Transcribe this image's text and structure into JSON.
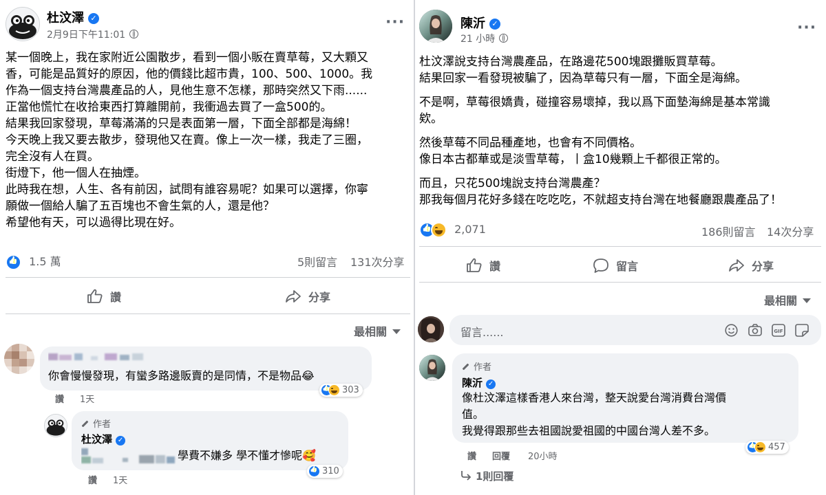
{
  "left_post": {
    "author": "杜汶澤",
    "timestamp": "2月9日下午11:01",
    "body_lines": [
      "某一個晚上，我在家附近公園散步，看到一個小販在賣草莓，又大顆又",
      "香，可能是品質好的原因，他的價錢比超市貴，100、500、1000。我",
      "作為一個支持台灣農產品的人，見他生意不怎樣，那時突然又下雨......",
      "正當他慌忙在收拾東西打算離開前，我衝過去買了一盒500的。",
      "結果我回家發現，草莓滿滿的只是表面第一層，下面全部都是海綿！",
      "今天晚上我又要去散步，發現他又在賣。像上一次一樣，我走了三圈，",
      "完全沒有人在買。",
      "街燈下，他一個人在抽煙。",
      "此時我在想，人生、各有前因，試問有誰容易呢？如果可以選擇，你寧",
      "願做一個給人騙了五百塊也不會生氣的人，還是他？",
      "希望他有天，可以過得比現在好。"
    ],
    "reactions_count": "1.5 萬",
    "comments_count": "5則留言",
    "shares_count": "131次分享",
    "like_label": "讚",
    "share_label": "分享",
    "sort_label": "最相關",
    "comments": [
      {
        "text": "你會慢慢發現，有蠻多路邊販賣的是同情，不是物品😂",
        "reaction_count": "303",
        "like_label": "讚",
        "time": "1天"
      }
    ],
    "reply": {
      "author_tag": "作者",
      "name": "杜汶澤",
      "text": "學費不嫌多 學不懂才慘呢🥰",
      "reaction_count": "310",
      "like_label": "讚",
      "time": "1天"
    }
  },
  "right_post": {
    "author": "陳沂",
    "timestamp": "21 小時",
    "body_lines": [
      "杜汶澤說支持台灣農產品，在路邊花500塊跟攤販買草莓。",
      "結果回家一看發現被騙了，因為草莓只有一層，下面全是海綿。",
      "",
      "不是啊，草莓很嬌貴，碰撞容易壞掉，我以爲下面墊海綿是基本常識",
      "欸。",
      "",
      "然後草莓不同品種產地，也會有不同價格。",
      "像日本古都華或是淡雪草莓，丨盒10幾顆上千都很正常的。",
      "",
      "而且，只花500塊說支持台灣農產？",
      "那我每個月花好多錢在吃吃吃，不就超支持台灣在地餐廳跟農產品了！"
    ],
    "reactions_count": "2,071",
    "comments_count": "186則留言",
    "shares_count": "14次分享",
    "like_label": "讚",
    "comment_label": "留言",
    "share_label": "分享",
    "sort_label": "最相關",
    "comment_placeholder": "留言......",
    "comment_box_icons": [
      "smiley-icon",
      "camera-icon",
      "gif-icon",
      "sticker-icon"
    ],
    "author_comment": {
      "author_tag": "作者",
      "name": "陳沂",
      "lines": [
        "像杜汶澤這樣香港人來台灣，整天說愛台灣消費台灣價",
        "值。",
        "我覺得跟那些去祖國說愛祖國的中國台灣人差不多。"
      ],
      "reaction_count": "457",
      "like_label": "讚",
      "reply_label": "回覆",
      "time": "20小時",
      "replies_link": "1則回覆"
    }
  },
  "colors": {
    "facebook_blue": "#1877f2",
    "haha_yellow": "#f7b928",
    "secondary_text": "#65676b",
    "bubble_bg": "#f0f2f5",
    "divider": "#ced0d4"
  }
}
